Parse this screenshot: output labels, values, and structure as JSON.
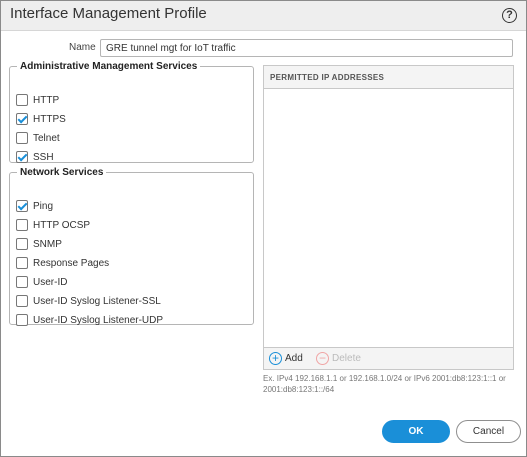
{
  "dialog": {
    "title": "Interface Management Profile",
    "help_glyph": "?"
  },
  "name": {
    "label": "Name",
    "value": "GRE tunnel mgt for IoT traffic"
  },
  "admin_services": {
    "legend": "Administrative Management Services",
    "items": [
      {
        "label": "HTTP",
        "checked": false
      },
      {
        "label": "HTTPS",
        "checked": true
      },
      {
        "label": "Telnet",
        "checked": false
      },
      {
        "label": "SSH",
        "checked": true
      }
    ]
  },
  "network_services": {
    "legend": "Network Services",
    "items": [
      {
        "label": "Ping",
        "checked": true
      },
      {
        "label": "HTTP OCSP",
        "checked": false
      },
      {
        "label": "SNMP",
        "checked": false
      },
      {
        "label": "Response Pages",
        "checked": false
      },
      {
        "label": "User-ID",
        "checked": false
      },
      {
        "label": "User-ID Syslog Listener-SSL",
        "checked": false
      },
      {
        "label": "User-ID Syslog Listener-UDP",
        "checked": false
      }
    ]
  },
  "permitted_ips": {
    "header": "PERMITTED IP ADDRESSES",
    "entries": [],
    "add_label": "Add",
    "delete_label": "Delete",
    "hint": "Ex. IPv4 192.168.1.1 or 192.168.1.0/24 or IPv6 2001:db8:123:1::1 or 2001:db8:123:1::/64"
  },
  "buttons": {
    "ok": "OK",
    "cancel": "Cancel"
  },
  "colors": {
    "accent": "#1a8fd8",
    "delete_disabled": "#f0a5a5"
  }
}
